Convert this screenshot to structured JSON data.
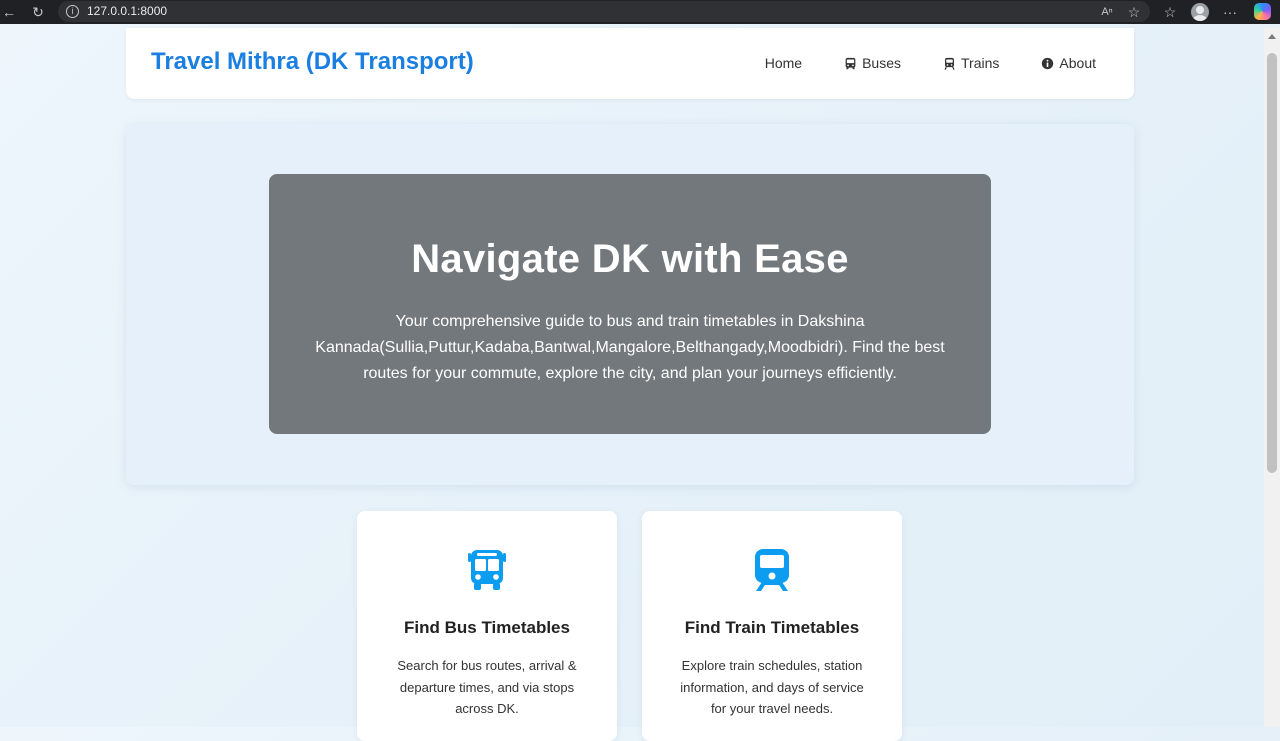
{
  "browser": {
    "url": "127.0.0.1:8000"
  },
  "nav": {
    "brand": "Travel Mithra (DK Transport)",
    "links": [
      {
        "label": "Home",
        "icon": "none"
      },
      {
        "label": "Buses",
        "icon": "bus-icon"
      },
      {
        "label": "Trains",
        "icon": "train-icon"
      },
      {
        "label": "About",
        "icon": "info-icon"
      }
    ]
  },
  "hero": {
    "title": "Navigate DK with Ease",
    "description": "Your comprehensive guide to bus and train timetables in Dakshina Kannada(Sullia,Puttur,Kadaba,Bantwal,Mangalore,Belthangady,Moodbidri). Find the best routes for your commute, explore the city, and plan your journeys efficiently."
  },
  "cards": [
    {
      "icon": "bus-icon",
      "title": "Find Bus Timetables",
      "text": "Search for bus routes, arrival & departure times, and via stops across DK."
    },
    {
      "icon": "train-icon",
      "title": "Find Train Timetables",
      "text": "Explore train schedules, station information, and days of service for your travel needs."
    }
  ],
  "colors": {
    "brand": "#1a7fe0",
    "icon_accent": "#0d9df0",
    "hero_bg": "#73787c"
  }
}
